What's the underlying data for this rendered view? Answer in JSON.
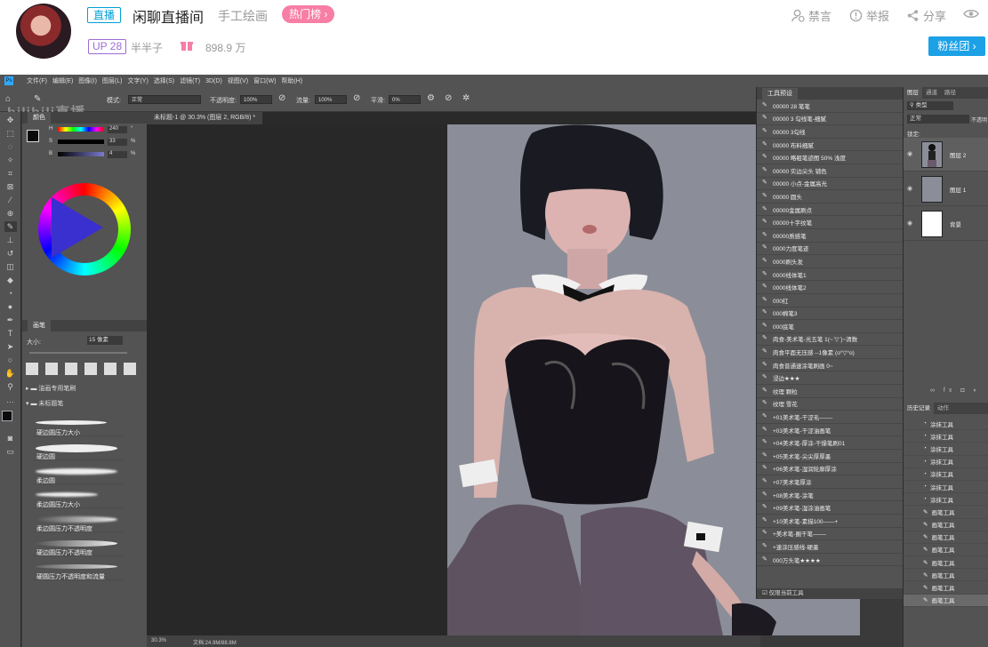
{
  "header": {
    "live_tag": "直播",
    "room_title": "闲聊直播间",
    "area": "手工绘画",
    "hot_tag": "热门榜",
    "up_badge": "UP 28",
    "up_name": "半半子",
    "popularity": "898.9 万",
    "actions": [
      {
        "label": "禁言",
        "icon": "user-block-icon"
      },
      {
        "label": "举报",
        "icon": "warning-icon"
      },
      {
        "label": "分享",
        "icon": "share-icon"
      }
    ],
    "fans_button": "粉丝团"
  },
  "ps": {
    "menu": [
      "文件(F)",
      "编辑(E)",
      "图像(I)",
      "图层(L)",
      "文字(Y)",
      "选择(S)",
      "滤镜(T)",
      "3D(D)",
      "视图(V)",
      "窗口(W)",
      "帮助(H)"
    ],
    "options": {
      "mode_label": "模式:",
      "mode_value": "正常",
      "opacity_label": "不透明度:",
      "opacity_value": "100%",
      "flow_label": "流量:",
      "flow_value": "100%",
      "smooth_label": "平滑:",
      "smooth_value": "0%"
    },
    "watermark": "bilibili直播",
    "color_panel": {
      "title": "颜色",
      "h_label": "H",
      "h_value": "240",
      "h_unit": "°",
      "s_label": "S",
      "s_value": "33",
      "s_unit": "%",
      "b_label": "B",
      "b_value": "4",
      "b_unit": "%",
      "hue": 240,
      "saturation": 33,
      "brightness": 4
    },
    "brush_panel": {
      "title": "画笔",
      "size_label": "大小:",
      "size_value": "15 像素",
      "groups": [
        "油画专用笔刷",
        "未标题笔"
      ],
      "brushes": [
        "硬边圆压力大小",
        "硬边圆",
        "柔边圆",
        "柔边圆压力大小",
        "柔边圆压力不透明度",
        "硬边圆压力不透明度",
        "硬圆压力不透明度和流量"
      ]
    },
    "doc_tab": "未标题-1 @ 30.3% (图层 2, RGB/8) *",
    "status": {
      "zoom": "30.3%",
      "doc": "文档:24.9M/88.8M"
    },
    "tool_presets": {
      "title": "工具预设",
      "items": [
        "00000 28 笔笔",
        "00000 3 勾线笔-细腻",
        "00000 3勾线",
        "00000 布料细腻",
        "00000 略粗笔迹图 50% 浅度",
        "00000 实边尖头 铺色",
        "00000 小点-金属高光",
        "00000 圆头",
        "00000金属刷点",
        "00000十字纹笔",
        "00000质感笔",
        "0000力度笔迹",
        "0000刷头发",
        "0000线体笔1",
        "0000线体笔2",
        "000红",
        "000棉笔3",
        "000底笔",
        "肉食-美术笔-光五笔 1(~ ̄▽ ̄)~清数",
        "肉食平面无压感 --1像素 (o°▽°o)",
        "肉食普通速涂笔刷画 0~",
        "浸边★★★",
        "纹理 颗粒",
        "纹理 雪花",
        "+01美术笔-干涩毛——-",
        "+03美术笔-干涩油画笔",
        "+04美术笔-厚涂-干燥笔刷01",
        "+05美术笔-尖尖厚厚墨",
        "+06美术笔-湿润轮廓厚涂",
        "+07美术笔厚涂",
        "+08美术笔-涂笔",
        "+09美术笔-湿涂油画笔",
        "+10美术笔-素描100——+",
        "+美术笔-圈干笔——-",
        "+速涂压感线-硬墨",
        "000万头笔★★★★"
      ],
      "footer": "仅限当前工具"
    },
    "layers_panel": {
      "tabs": [
        "图层",
        "通道",
        "路径"
      ],
      "kind_label": "类型",
      "blend": "正常",
      "opacity_label": "不透明",
      "lock_label": "锁定:",
      "layers": [
        {
          "name": "图层 2",
          "thumb": "figure"
        },
        {
          "name": "图层 1",
          "thumb": "#8b8e99"
        },
        {
          "name": "背景",
          "thumb": "#ffffff"
        }
      ]
    },
    "history_panel": {
      "tabs": [
        "历史记录",
        "动作"
      ],
      "items": [
        "涂抹工具",
        "涂抹工具",
        "涂抹工具",
        "涂抹工具",
        "涂抹工具",
        "涂抹工具",
        "涂抹工具",
        "画笔工具",
        "画笔工具",
        "画笔工具",
        "画笔工具",
        "画笔工具",
        "画笔工具",
        "画笔工具",
        "画笔工具"
      ]
    }
  }
}
